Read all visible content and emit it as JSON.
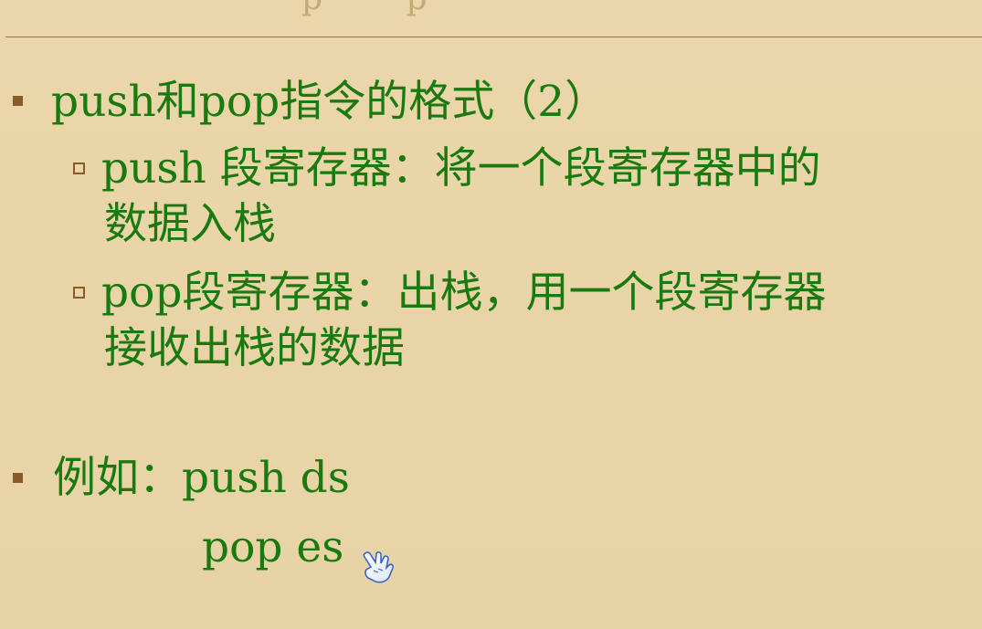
{
  "slide": {
    "bullet1": "push和pop指令的格式（2）",
    "sub1_line1": "push 段寄存器：将一个段寄存器中的",
    "sub1_line2": "数据入栈",
    "sub2_line1": "pop段寄存器：出栈，用一个段寄存器",
    "sub2_line2": "接收出栈的数据",
    "example_label": "例如：push ds",
    "example_line2": "pop es"
  },
  "icons": {
    "cursor": "hand-pointer-icon"
  },
  "colors": {
    "background": "#e8d4a8",
    "text": "#1a7a10",
    "bullet": "#8b5a2b",
    "rule": "#8f7455"
  }
}
